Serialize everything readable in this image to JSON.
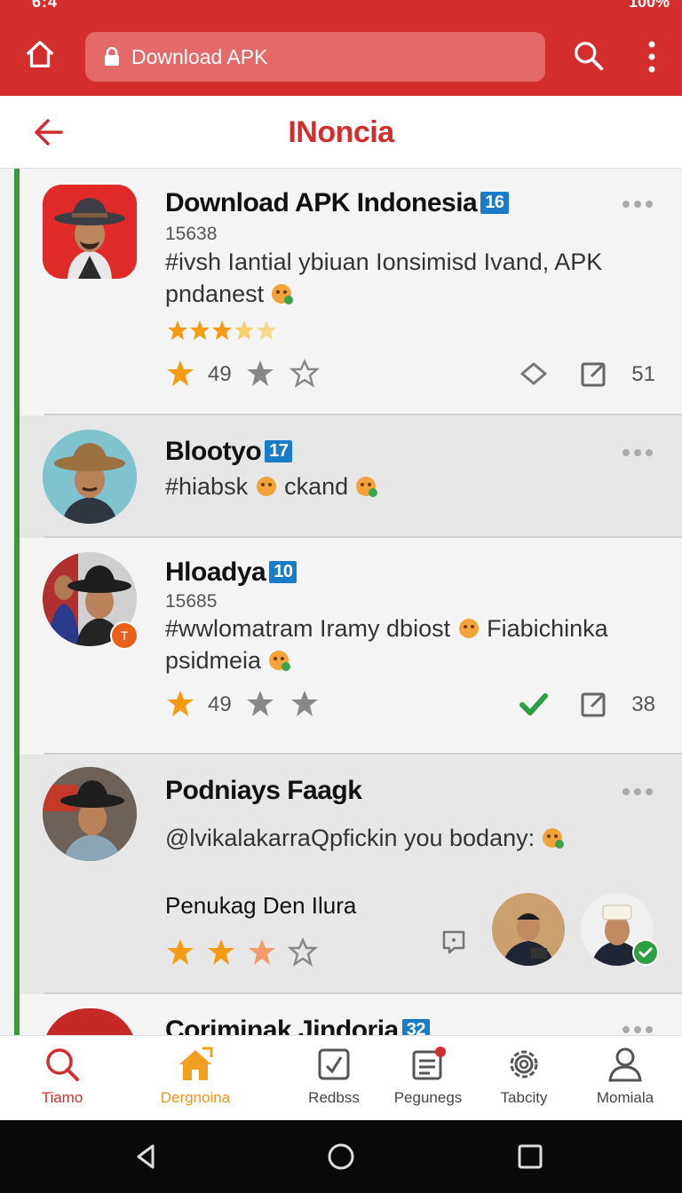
{
  "status_bar": {
    "time": "6:4",
    "battery": "100%"
  },
  "browser": {
    "url_text": "Download APK"
  },
  "header": {
    "title": "INoncia"
  },
  "colors": {
    "brand": "#d42d2d",
    "accent_green": "#3a9a3a",
    "badge_blue": "#1a7cc6",
    "star_orange": "#f39c12"
  },
  "posts": [
    {
      "name": "Download APK Indonesia",
      "badge": "16",
      "id": "15638",
      "text": "#ivsh Iantial ybiuan Ionsimisd Ivand, APK pndanest",
      "rating": 3.5,
      "likes": "49",
      "comments": "51",
      "action_icon": "share-icon"
    },
    {
      "name": "Blootyo",
      "badge": "17",
      "text_a": "#hiabsk",
      "text_b": "ckand"
    },
    {
      "name": "Hloadya",
      "badge": "10",
      "id": "15685",
      "text_a": "#wwlomatram Iramy dbiost",
      "text_b": "Fiabichinka psidmeia",
      "likes": "49",
      "comments": "38",
      "action_icon": "check-icon"
    },
    {
      "name": "Podniays Faagk",
      "text": "@lvikalakarraQpfickin you bodany:",
      "subtitle": "Penukag Den Ilura",
      "rating": 2.5
    },
    {
      "name": "Coriminak Jindoria",
      "badge": "32"
    }
  ],
  "bottom_nav": [
    {
      "label": "Tiamo",
      "icon": "search-icon"
    },
    {
      "label": "Dergnoina",
      "icon": "home-icon"
    },
    {
      "label": "Redbss",
      "icon": "check-box-icon"
    },
    {
      "label": "Pegunegs",
      "icon": "news-icon"
    },
    {
      "label": "Tabcity",
      "icon": "gear-icon"
    },
    {
      "label": "Momiala",
      "icon": "person-icon"
    }
  ]
}
